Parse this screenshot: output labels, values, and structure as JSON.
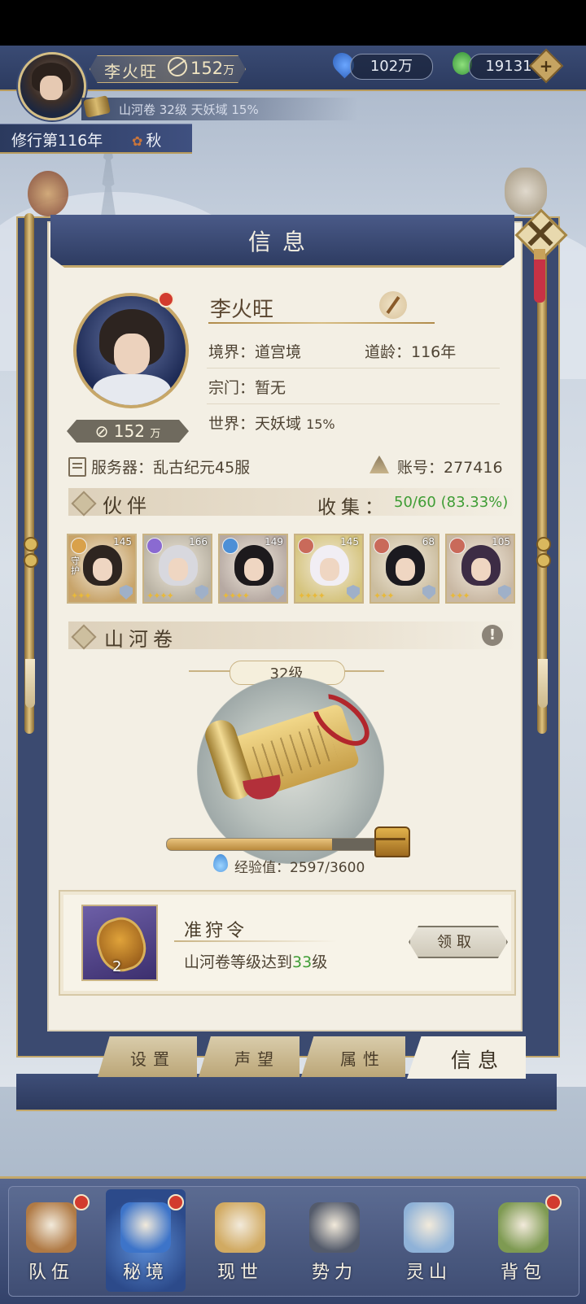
{
  "player": {
    "name": "李火旺",
    "power_value": "152",
    "power_unit": "万",
    "scroll_summary": "山河卷 32级 天妖域 15%"
  },
  "resources": {
    "spirit_stones": "102万",
    "jade": "19131",
    "add_symbol": "+"
  },
  "calendar": {
    "year_text": "修行第116年",
    "season": "秋"
  },
  "panel": {
    "title": "信息",
    "profile": {
      "name": "李火旺",
      "realm": "境界：道宫境",
      "age": "道龄：116年",
      "sect": "宗门：暂无",
      "world_label": "世界：天妖域",
      "world_pct": "15%",
      "power_value": "152",
      "power_unit": "万"
    },
    "server": "服务器：乱古纪元45服",
    "account": "账号：277416",
    "partners": {
      "title": "伙伴",
      "collect_label": "收集：",
      "collect_value": "50/60 (83.33%)",
      "items": [
        {
          "level": "145",
          "role": "守护",
          "stars": 3,
          "badge_color": "#d9a14a",
          "hair": "#2e2520",
          "bg": "#c8a46a"
        },
        {
          "level": "166",
          "role": "",
          "stars": 4,
          "badge_color": "#8a6ad1",
          "hair": "#d8d8de",
          "bg": "#b9b2a3"
        },
        {
          "level": "149",
          "role": "",
          "stars": 4,
          "badge_color": "#4d8fd6",
          "hair": "#1d1a1d",
          "bg": "#b6a9a2"
        },
        {
          "level": "145",
          "role": "",
          "stars": 4,
          "badge_color": "#c96a5a",
          "hair": "#f1eef4",
          "bg": "#d5c47e"
        },
        {
          "level": "68",
          "role": "",
          "stars": 3,
          "badge_color": "#c96a5a",
          "hair": "#1b1a20",
          "bg": "#cbbd9f"
        },
        {
          "level": "105",
          "role": "",
          "stars": 3,
          "badge_color": "#c96a5a",
          "hair": "#3d2c45",
          "bg": "#c9b8a3"
        }
      ]
    },
    "scroll": {
      "title": "山河卷",
      "level": "32级",
      "exp_label": "经验值：2597/3600",
      "exp_fraction": 0.7214
    },
    "reward": {
      "title": "准狩令",
      "count": "2",
      "desc_prefix": "山河卷等级达到",
      "desc_level": "33",
      "desc_suffix": "级",
      "claim": "领取"
    },
    "tabs": [
      "设置",
      "声望",
      "属性",
      "信息"
    ],
    "active_tab": 3
  },
  "bottom_nav": [
    {
      "label": "队伍",
      "dot": true,
      "color": "#b07a45"
    },
    {
      "label": "秘境",
      "dot": true,
      "color": "#3d74c9"
    },
    {
      "label": "现世",
      "dot": false,
      "color": "#d1aa62"
    },
    {
      "label": "势力",
      "dot": false,
      "color": "#545b6b"
    },
    {
      "label": "灵山",
      "dot": false,
      "color": "#8fb2d8"
    },
    {
      "label": "背包",
      "dot": true,
      "color": "#7e9a52"
    }
  ]
}
